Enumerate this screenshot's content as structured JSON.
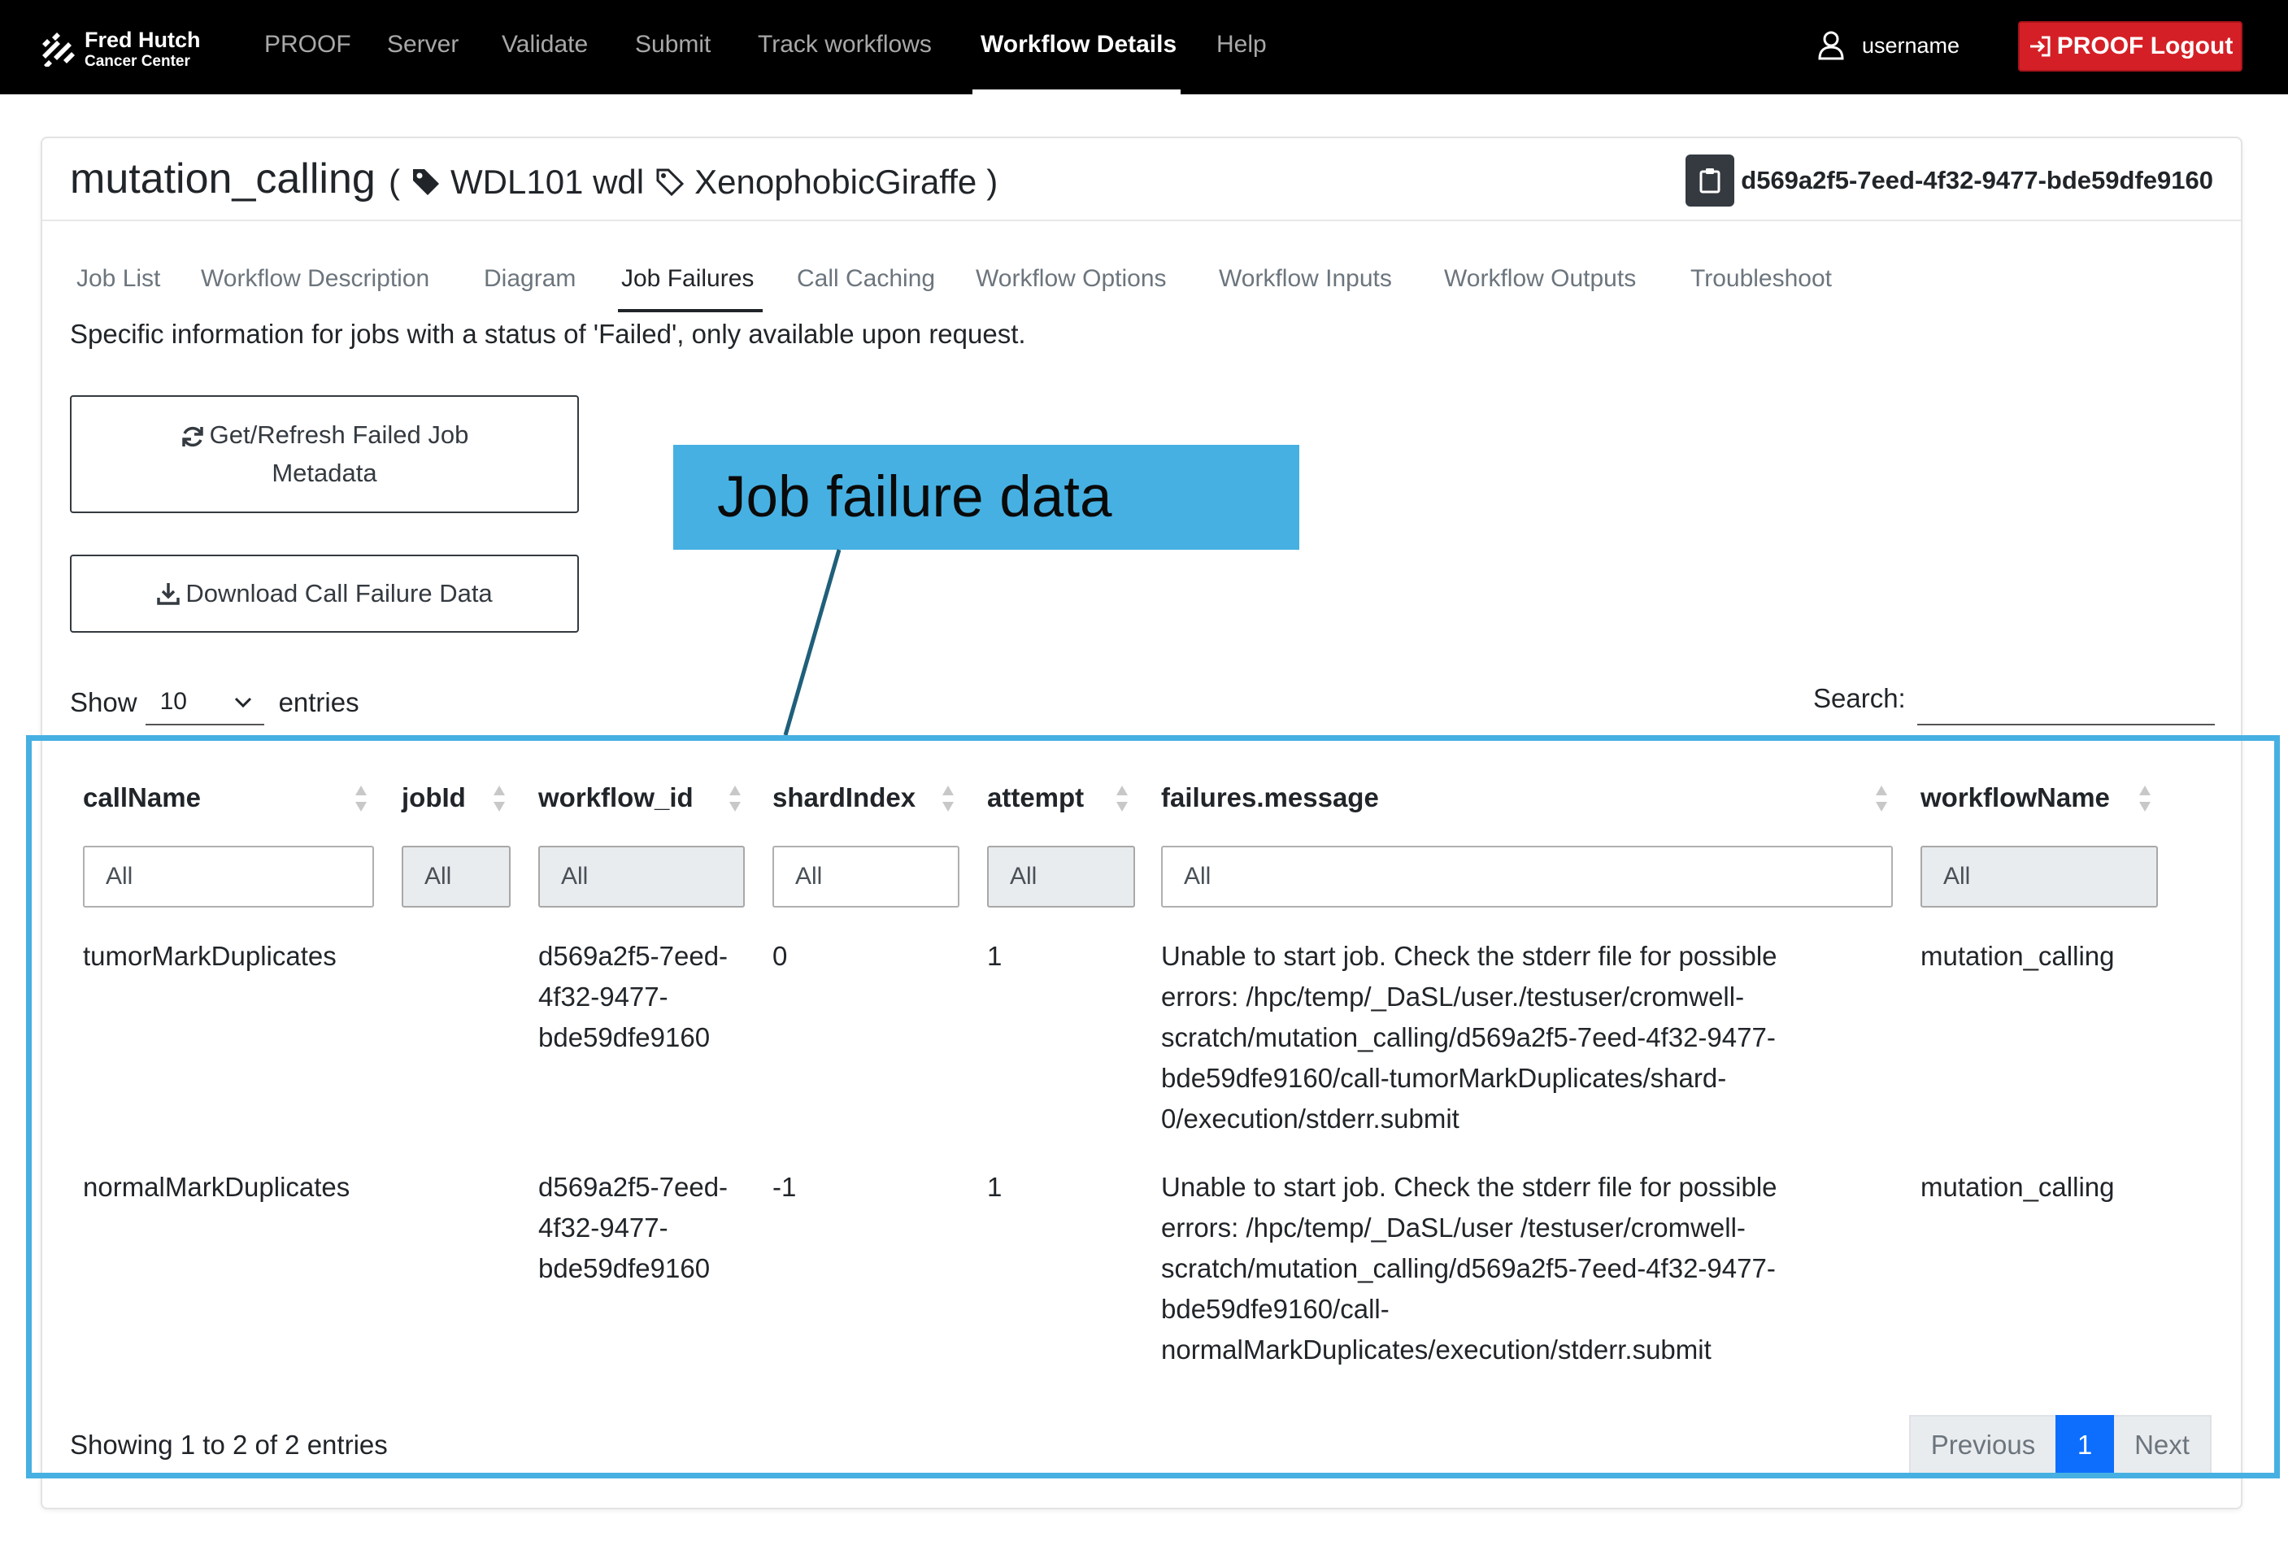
{
  "brand": {
    "line1": "Fred Hutch",
    "line2": "Cancer Center"
  },
  "nav": {
    "items": [
      "PROOF",
      "Server",
      "Validate",
      "Submit",
      "Track workflows",
      "Workflow Details",
      "Help"
    ],
    "active": "Workflow Details",
    "username": "username",
    "logout_label": "PROOF Logout"
  },
  "workflow": {
    "name": "mutation_calling",
    "open_paren": "(",
    "tag1": "WDL101 wdl",
    "tag2": "XenophobicGiraffe",
    "close_paren": ")",
    "id": "d569a2f5-7eed-4f32-9477-bde59dfe9160"
  },
  "tabs": [
    "Job List",
    "Workflow Description",
    "Diagram",
    "Job Failures",
    "Call Caching",
    "Workflow Options",
    "Workflow Inputs",
    "Workflow Outputs",
    "Troubleshoot"
  ],
  "active_tab": "Job Failures",
  "description": "Specific information for jobs with a status of 'Failed', only available upon request.",
  "buttons": {
    "refresh_line1": "Get/Refresh Failed Job",
    "refresh_line2": "Metadata",
    "download": "Download Call Failure Data"
  },
  "callout": "Job failure data",
  "table_controls": {
    "show": "Show",
    "length": "10",
    "entries": "entries",
    "search": "Search:"
  },
  "columns": [
    "callName",
    "jobId",
    "workflow_id",
    "shardIndex",
    "attempt",
    "failures.message",
    "workflowName"
  ],
  "filter_placeholder": "All",
  "rows": [
    {
      "callName": "tumorMarkDuplicates",
      "jobId": "",
      "workflow_id": [
        "d569a2f5-7eed-",
        "4f32-9477-",
        "bde59dfe9160"
      ],
      "shardIndex": "0",
      "attempt": "1",
      "message": [
        "Unable to start job. Check the stderr file for possible",
        "errors: /hpc/temp/_DaSL/user./testuser/cromwell-",
        "scratch/mutation_calling/d569a2f5-7eed-4f32-9477-",
        "bde59dfe9160/call-tumorMarkDuplicates/shard-",
        "0/execution/stderr.submit"
      ],
      "workflowName": "mutation_calling"
    },
    {
      "callName": "normalMarkDuplicates",
      "jobId": "",
      "workflow_id": [
        "d569a2f5-7eed-",
        "4f32-9477-",
        "bde59dfe9160"
      ],
      "shardIndex": "-1",
      "attempt": "1",
      "message": [
        "Unable to start job. Check the stderr file for possible",
        "errors: /hpc/temp/_DaSL/user /testuser/cromwell-",
        "scratch/mutation_calling/d569a2f5-7eed-4f32-9477-",
        "bde59dfe9160/call-",
        "normalMarkDuplicates/execution/stderr.submit"
      ],
      "workflowName": "mutation_calling"
    }
  ],
  "info": "Showing 1 to 2 of 2 entries",
  "pagination": {
    "previous": "Previous",
    "current": "1",
    "next": "Next"
  },
  "colors": {
    "navbar": "#000000",
    "logout": "#d51f26",
    "callout": "#46b0e2",
    "page_active": "#0d6efd"
  },
  "icons": [
    "fred-hutch-logo-icon",
    "user-icon",
    "logout-icon",
    "tag-icon",
    "clipboard-icon",
    "refresh-icon",
    "download-icon",
    "chevron-down-icon",
    "sort-icon"
  ]
}
